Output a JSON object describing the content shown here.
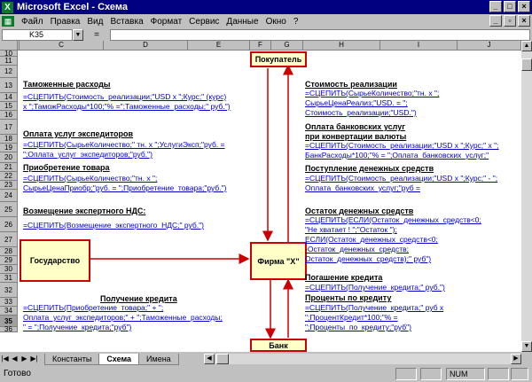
{
  "window": {
    "title": "Microsoft Excel - Схема",
    "app_icon": "X"
  },
  "menu": [
    "Файл",
    "Правка",
    "Вид",
    "Вставка",
    "Формат",
    "Сервис",
    "Данные",
    "Окно",
    "?"
  ],
  "formula_bar": {
    "cell_ref": "K35",
    "equals": "=",
    "value": ""
  },
  "columns": [
    "C",
    "D",
    "E",
    "F",
    "G",
    "H",
    "I",
    "J"
  ],
  "rows": [
    "10",
    "11",
    "12",
    "13",
    "14",
    "15",
    "16",
    "17",
    "18",
    "19",
    "20",
    "21",
    "22",
    "23",
    "24",
    "25",
    "26",
    "27",
    "28",
    "29",
    "30",
    "31",
    "32",
    "33",
    "34",
    "35",
    "36"
  ],
  "boxes": {
    "buyer": "Покупатель",
    "state": "Государство",
    "firm": "Фирма \"X\"",
    "bank": "Банк"
  },
  "left": {
    "customs_label": "Таможенные расходы",
    "customs_f1": "=СЦЕПИТЬ(Стоимость_реализации;\"USD x \";Курс;\" (курс)",
    "customs_f2": "x \";ТаможРасходы*100;\"% =\";Таможенные_расходы;\" руб.\")",
    "exp_label": "Оплата услуг экспедиторов",
    "exp_f1": "=СЦЕПИТЬ(СырьеКоличество;\" тн. x \";УслугиЭксп;\"руб. =",
    "exp_f2": "\";Оплата_услуг_экспедиторов;\"руб.\")",
    "goods_label": "Приобретение товара",
    "goods_f1": "=СЦЕПИТЬ(СырьеКоличество;\"тн. x \";",
    "goods_f2": "СырьеЦенаПриобр;\"руб. = \";Приобретение_товара;\"руб.\")",
    "vat_label": "Возмещение экспертного НДС:",
    "vat_f1": "=СЦЕПИТЬ(Возмещение_экспертного_НДС;\" руб.\")",
    "credit_label": "Получение кредита",
    "credit_f1": "=СЦЕПИТЬ(Приобретение_товара;\" + \";",
    "credit_f2": "Оплата_услуг_экспедиторов;\" + \";Таможенные_расходы;",
    "credit_f3": "\" = \";Получение_кредита;\"руб\")"
  },
  "right": {
    "sales_label": "Стоимость реализации",
    "sales_f1": "=СЦЕПИТЬ(СырьеКоличество;\"тн. x \";",
    "sales_f2": "СырьеЦенаРеализ;\"USD. = \";",
    "sales_f3": "Стоимость_реализации;\"USD.\")",
    "bankfee_label1": "Оплата банковских услуг",
    "bankfee_label2": "при конвертации валюты",
    "bankfee_f1": "=СЦЕПИТЬ(Стоимость_реализации;\"USD x \";Курс;\" x \";",
    "bankfee_f2": "БанкРасходы*100;\"% = \";Оплата_банковских_услуг;\"",
    "income_label": "Поступление денежных средств",
    "income_f1": "=СЦЕПИТЬ(Стоимость_реализации;\"USD x \";Курс;\" - \";",
    "income_f2": "Оплата_банковских_услуг;\"руб =",
    "balance_label": "Остаток денежных средств",
    "balance_f1": "=СЦЕПИТЬ(ЕСЛИ(Остаток_денежных_средств<0;",
    "balance_f2": "\"Не хватает ! \";\"Остаток \");",
    "balance_f3": "ЕСЛИ(Остаток_денежных_средств<0;",
    "balance_f4": "-Остаток_денежных_средств;",
    "balance_f5": "Остаток_денежных_средств);\" руб\")",
    "repay_label": "Погашение кредита",
    "repay_f1": "=СЦЕПИТЬ(Получение_кредита;\" руб.\")",
    "interest_label": "Проценты по кредиту",
    "interest_f1": "=СЦЕПИТЬ(Получение_кредита;\" руб x",
    "interest_f2": "\";ПроцентКредит*100;\"% =",
    "interest_f3": "\";Проценты_по_кредиту;\"руб\")"
  },
  "tabs": [
    "Константы",
    "Схема",
    "Имена"
  ],
  "status": {
    "text": "Готово",
    "num": "NUM"
  }
}
